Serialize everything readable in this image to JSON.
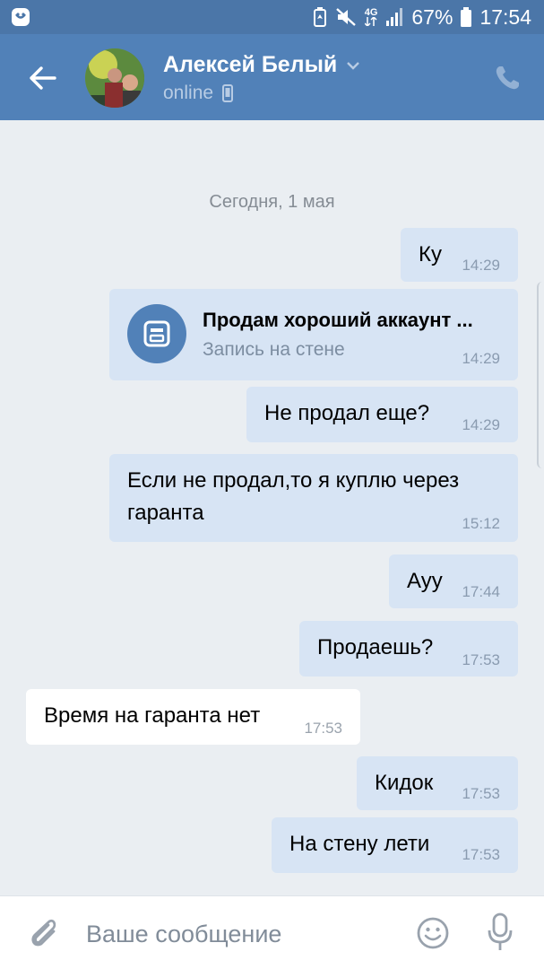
{
  "status_bar": {
    "network": "4G",
    "battery": "67%",
    "time": "17:54"
  },
  "header": {
    "contact_name": "Алексей Белый",
    "contact_status": "online"
  },
  "chat": {
    "date_separator": "Сегодня, 1 мая",
    "messages": [
      {
        "direction": "out",
        "text": "Ку",
        "time": "14:29"
      },
      {
        "direction": "out",
        "type": "wall_post",
        "title": "Продам хороший аккаунт ...",
        "subtitle": "Запись на стене",
        "time": "14:29"
      },
      {
        "direction": "out",
        "text": "Не продал еще?",
        "time": "14:29"
      },
      {
        "direction": "out",
        "text_line1": "Если не продал,то я куплю через",
        "text_line2": "гаранта",
        "time": "15:12"
      },
      {
        "direction": "out",
        "text": "Ауу",
        "time": "17:44"
      },
      {
        "direction": "out",
        "text": "Продаешь?",
        "time": "17:53"
      },
      {
        "direction": "in",
        "text": "Время на гаранта нет",
        "time": "17:53"
      },
      {
        "direction": "out",
        "text": "Кидок",
        "time": "17:53"
      },
      {
        "direction": "out",
        "text": "На стену лети",
        "time": "17:53"
      }
    ]
  },
  "composer": {
    "placeholder": "Ваше сообщение"
  },
  "colors": {
    "header_bg": "#5181b8",
    "status_bar_bg": "#4b76a8",
    "outgoing_bubble": "#d7e4f4",
    "incoming_bubble": "#ffffff",
    "chat_bg": "#eaeef2"
  },
  "icons": {
    "back": "arrow-left-icon",
    "call": "phone-icon",
    "attach": "paperclip-icon",
    "emoji": "smiley-icon",
    "mic": "microphone-icon",
    "wall": "wall-post-icon",
    "mobile": "mobile-device-icon",
    "dropdown": "chevron-down-icon"
  }
}
